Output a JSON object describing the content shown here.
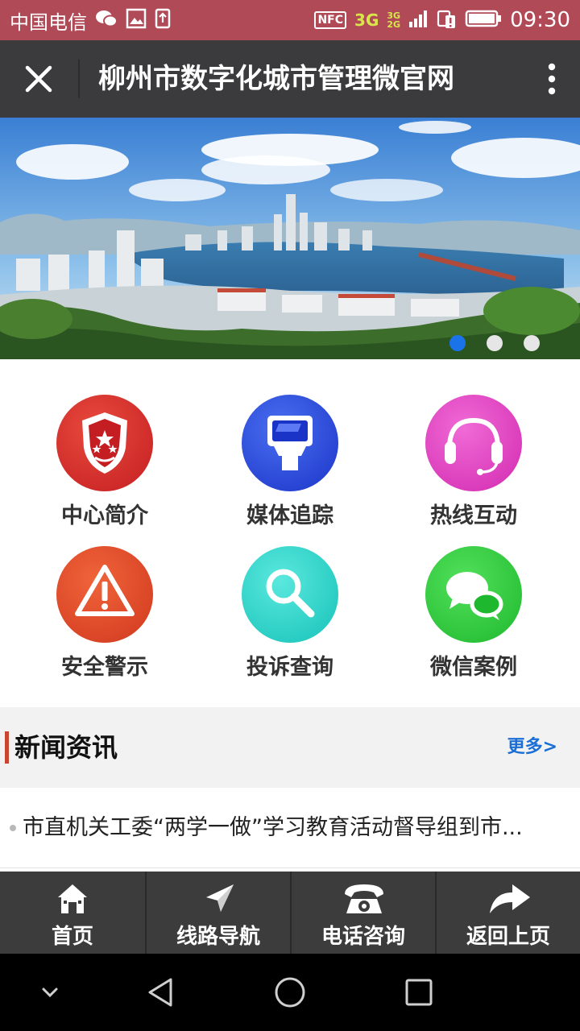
{
  "status_bar": {
    "carrier": "中国电信",
    "nfc": "NFC",
    "net_3g": "3G",
    "net_3g_small": "3G",
    "net_2g_small": "2G",
    "time": "09:30"
  },
  "title_bar": {
    "title": "柳州市数字化城市管理微官网",
    "close_icon": "close-icon",
    "more_icon": "more-vertical-icon"
  },
  "banner": {
    "slides": 3,
    "active_slide": 1
  },
  "grid": {
    "items": [
      {
        "label": "中心简介",
        "icon": "badge-icon",
        "color": "#d42a2a"
      },
      {
        "label": "媒体追踪",
        "icon": "flash-icon",
        "color": "#2a4fe0"
      },
      {
        "label": "热线互动",
        "icon": "headset-icon",
        "color": "#e040c0"
      },
      {
        "label": "安全警示",
        "icon": "warning-icon",
        "color": "#e04a28"
      },
      {
        "label": "投诉查询",
        "icon": "search-icon",
        "color": "#2ad6cc"
      },
      {
        "label": "微信案例",
        "icon": "chat-icon",
        "color": "#2ecc40"
      }
    ]
  },
  "news": {
    "title": "新闻资讯",
    "more": "更多>",
    "items": [
      {
        "text": "市直机关工委“两学一做”学习教育活动督导组到市..."
      }
    ]
  },
  "bottom_nav": {
    "items": [
      {
        "label": "首页",
        "icon": "home-icon"
      },
      {
        "label": "线路导航",
        "icon": "navigation-icon"
      },
      {
        "label": "电话咨询",
        "icon": "phone-icon"
      },
      {
        "label": "返回上页",
        "icon": "back-arrow-icon"
      }
    ]
  }
}
